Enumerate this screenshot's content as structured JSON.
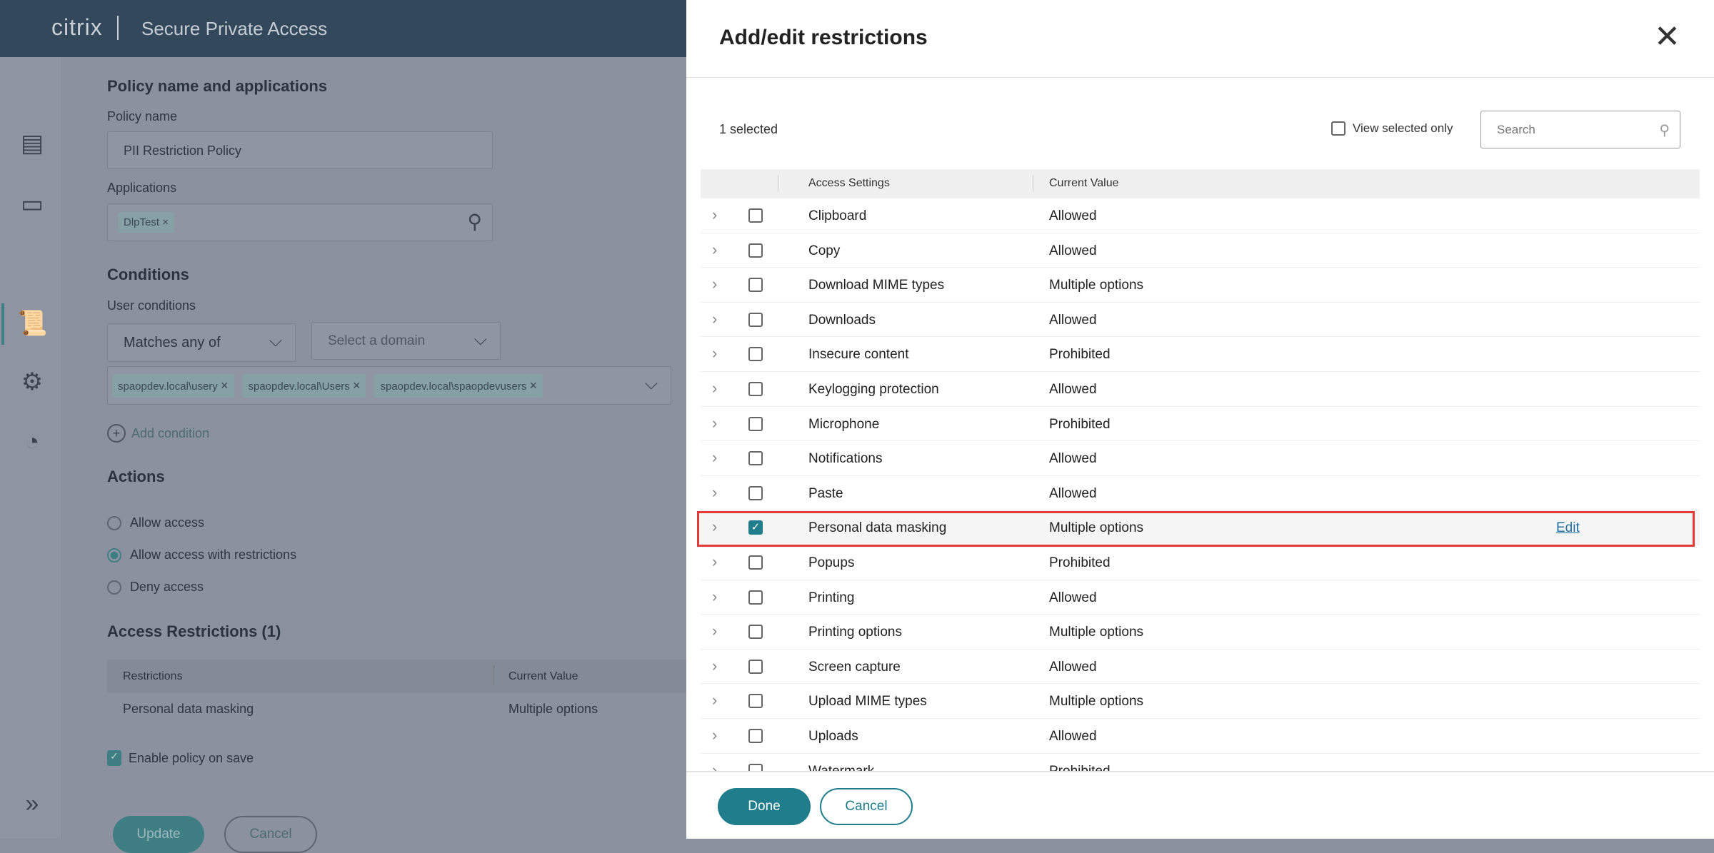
{
  "header": {
    "logo": "citrix",
    "title": "Secure Private Access"
  },
  "sidebar": {
    "icons": [
      "policy-list-icon",
      "application-window-icon",
      "policy-scroll-icon",
      "gear-icon",
      "dashboard-gauge-icon"
    ],
    "expand_icon": "double-chevron-right-icon"
  },
  "form": {
    "section1": "Policy name and applications",
    "policy_name_label": "Policy name",
    "policy_name_value": "PII Restriction Policy",
    "applications_label": "Applications",
    "application_chip": "DlpTest",
    "conditions_title": "Conditions",
    "user_conditions_label": "User conditions",
    "match_select": "Matches any of",
    "domain_placeholder": "Select a domain",
    "user_chips": [
      "spaopdev.local\\usery",
      "spaopdev.local\\Users",
      "spaopdev.local\\spaopdevusers"
    ],
    "add_condition": "Add condition",
    "actions_title": "Actions",
    "actions": [
      {
        "label": "Allow access",
        "selected": false
      },
      {
        "label": "Allow access with restrictions",
        "selected": true
      },
      {
        "label": "Deny access",
        "selected": false
      }
    ],
    "restrictions_title": "Access Restrictions (1)",
    "restrictions_columns": [
      "Restrictions",
      "Current Value"
    ],
    "restrictions_rows": [
      {
        "name": "Personal data masking",
        "value": "Multiple options"
      }
    ],
    "enable_on_save": "Enable policy on save",
    "update": "Update",
    "cancel": "Cancel"
  },
  "panel": {
    "title": "Add/edit restrictions",
    "selected_count": "1 selected",
    "view_selected_only": "View selected only",
    "search_placeholder": "Search",
    "columns": [
      "Access Settings",
      "Current Value"
    ],
    "rows": [
      {
        "name": "Clipboard",
        "value": "Allowed",
        "checked": false
      },
      {
        "name": "Copy",
        "value": "Allowed",
        "checked": false
      },
      {
        "name": "Download MIME types",
        "value": "Multiple options",
        "checked": false
      },
      {
        "name": "Downloads",
        "value": "Allowed",
        "checked": false
      },
      {
        "name": "Insecure content",
        "value": "Prohibited",
        "checked": false
      },
      {
        "name": "Keylogging protection",
        "value": "Allowed",
        "checked": false
      },
      {
        "name": "Microphone",
        "value": "Prohibited",
        "checked": false
      },
      {
        "name": "Notifications",
        "value": "Allowed",
        "checked": false
      },
      {
        "name": "Paste",
        "value": "Allowed",
        "checked": false
      },
      {
        "name": "Personal data masking",
        "value": "Multiple options",
        "checked": true,
        "edit": "Edit"
      },
      {
        "name": "Popups",
        "value": "Prohibited",
        "checked": false
      },
      {
        "name": "Printing",
        "value": "Allowed",
        "checked": false
      },
      {
        "name": "Printing options",
        "value": "Multiple options",
        "checked": false
      },
      {
        "name": "Screen capture",
        "value": "Allowed",
        "checked": false
      },
      {
        "name": "Upload MIME types",
        "value": "Multiple options",
        "checked": false
      },
      {
        "name": "Uploads",
        "value": "Allowed",
        "checked": false
      },
      {
        "name": "Watermark",
        "value": "Prohibited",
        "checked": false
      }
    ],
    "done": "Done",
    "cancel": "Cancel"
  },
  "colors": {
    "accent": "#1f7d8c",
    "highlight": "#e53935",
    "header": "#33485b"
  }
}
